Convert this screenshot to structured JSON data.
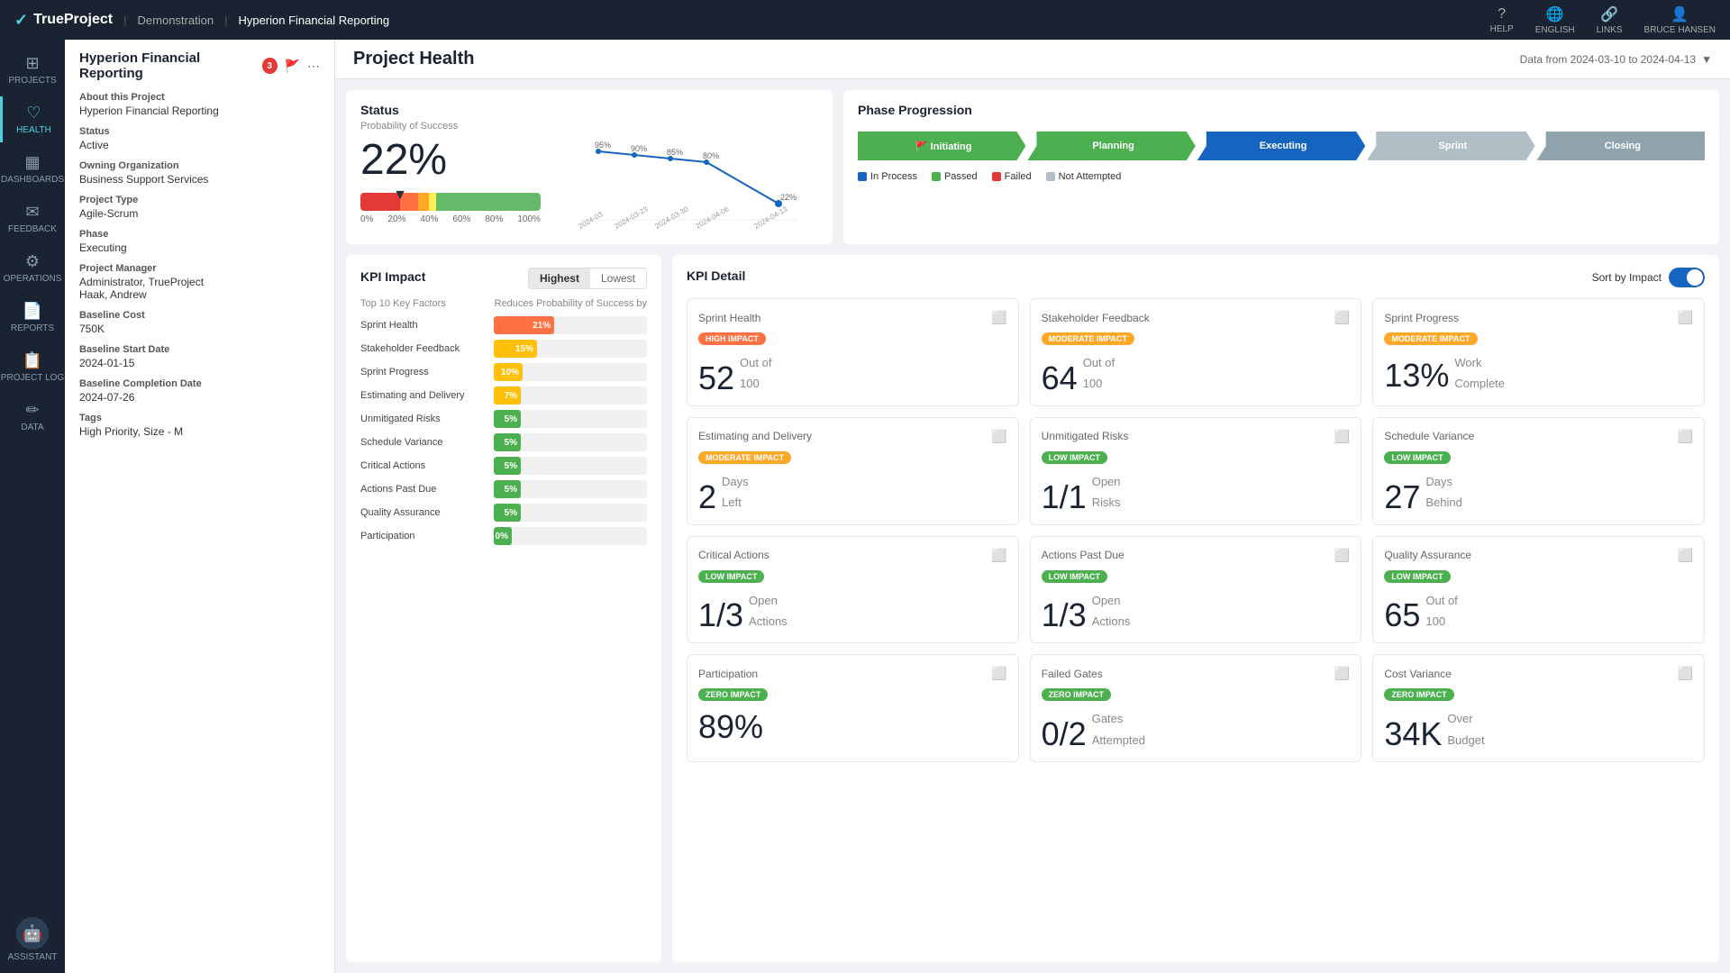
{
  "app": {
    "name": "TrueProject",
    "env": "Demonstration",
    "project": "Hyperion Financial Reporting"
  },
  "nav": {
    "help": "HELP",
    "language": "ENGLISH",
    "links": "LINKS",
    "user": "BRUCE HANSEN"
  },
  "sidebar": {
    "items": [
      {
        "id": "projects",
        "label": "PROJECTS",
        "icon": "⊞"
      },
      {
        "id": "health",
        "label": "HEALTH",
        "icon": "♡",
        "active": true
      },
      {
        "id": "dashboards",
        "label": "DASHBOARDS",
        "icon": "◫"
      },
      {
        "id": "feedback",
        "label": "FEEDBACK",
        "icon": "✉"
      },
      {
        "id": "operations",
        "label": "OPERATIONS",
        "icon": "⚙"
      },
      {
        "id": "reports",
        "label": "REPORTS",
        "icon": "📄"
      },
      {
        "id": "project_log",
        "label": "PROJECT LOG",
        "icon": "📋"
      },
      {
        "id": "data",
        "label": "DATA",
        "icon": "✏"
      }
    ],
    "assistant": "ASSISTANT"
  },
  "page": {
    "title": "Project Health",
    "date_range": "Data from 2024-03-10 to 2024-04-13"
  },
  "project_info": {
    "name": "Hyperion Financial Reporting",
    "badge": "3",
    "about_label": "About this Project",
    "about_value": "Hyperion Financial Reporting",
    "status_label": "Status",
    "status_value": "Active",
    "org_label": "Owning Organization",
    "org_value": "Business Support Services",
    "type_label": "Project Type",
    "type_value": "Agile-Scrum",
    "phase_label": "Phase",
    "phase_value": "Executing",
    "manager_label": "Project Manager",
    "manager_value": "Administrator, TrueProject\nHaak, Andrew",
    "cost_label": "Baseline Cost",
    "cost_value": "750K",
    "start_label": "Baseline Start Date",
    "start_value": "2024-01-15",
    "completion_label": "Baseline Completion Date",
    "completion_value": "2024-07-26",
    "tags_label": "Tags",
    "tags_value": "High Priority, Size - M"
  },
  "status": {
    "title": "Status",
    "subtitle": "Probability of Success",
    "percent": "22%",
    "chart_points": [
      {
        "label": "2024-03",
        "y": 95
      },
      {
        "label": "2024-03-23",
        "y": 90
      },
      {
        "label": "2024-03-30",
        "y": 85
      },
      {
        "label": "2024-04-06",
        "y": 80
      },
      {
        "label": "2024-04-13",
        "y": 22
      }
    ],
    "chart_labels": [
      "95%",
      "90%",
      "85%",
      "80%",
      "",
      "22%"
    ],
    "bar_labels": [
      "0%",
      "20%",
      "40%",
      "60%",
      "80%",
      "100%"
    ]
  },
  "phase_progression": {
    "title": "Phase Progression",
    "phases": [
      {
        "label": "Initiating",
        "status": "passed",
        "has_flag": true
      },
      {
        "label": "Planning",
        "status": "passed"
      },
      {
        "label": "Executing",
        "status": "in_process"
      },
      {
        "label": "Sprint",
        "status": "not_attempted"
      },
      {
        "label": "Closing",
        "status": "not_attempted"
      }
    ],
    "legend": [
      {
        "label": "In Process",
        "color": "#1565c0"
      },
      {
        "label": "Passed",
        "color": "#4caf50"
      },
      {
        "label": "Failed",
        "color": "#e53935"
      },
      {
        "label": "Not Attempted",
        "color": "#b0bec5"
      }
    ]
  },
  "kpi_impact": {
    "title": "KPI Impact",
    "toggle_highest": "Highest",
    "toggle_lowest": "Lowest",
    "col1": "Top 10 Key Factors",
    "col2": "Reduces Probability of Success by",
    "items": [
      {
        "label": "Sprint Health",
        "pct": 21,
        "color": "#ff7043",
        "pct_label": "21%"
      },
      {
        "label": "Stakeholder Feedback",
        "pct": 15,
        "color": "#ffc107",
        "pct_label": "15%"
      },
      {
        "label": "Sprint Progress",
        "pct": 10,
        "color": "#ffc107",
        "pct_label": "10%"
      },
      {
        "label": "Estimating and Delivery",
        "pct": 7,
        "color": "#ffc107",
        "pct_label": "7%"
      },
      {
        "label": "Unmitigated Risks",
        "pct": 5,
        "color": "#4caf50",
        "pct_label": "5%"
      },
      {
        "label": "Schedule Variance",
        "pct": 5,
        "color": "#4caf50",
        "pct_label": "5%"
      },
      {
        "label": "Critical Actions",
        "pct": 5,
        "color": "#4caf50",
        "pct_label": "5%"
      },
      {
        "label": "Actions Past Due",
        "pct": 5,
        "color": "#4caf50",
        "pct_label": "5%"
      },
      {
        "label": "Quality Assurance",
        "pct": 5,
        "color": "#4caf50",
        "pct_label": "5%"
      },
      {
        "label": "Participation",
        "pct": 0,
        "color": "#4caf50",
        "pct_label": "0%"
      }
    ]
  },
  "kpi_detail": {
    "title": "KPI Detail",
    "sort_label": "Sort by Impact",
    "cards": [
      {
        "title": "Sprint Health",
        "impact": "HIGH IMPACT",
        "impact_class": "high-impact",
        "value": "52",
        "suffix": "Out of",
        "suffix2": "100",
        "value_type": "number"
      },
      {
        "title": "Stakeholder Feedback",
        "impact": "MODERATE IMPACT",
        "impact_class": "moderate-impact",
        "value": "64",
        "suffix": "Out of",
        "suffix2": "100",
        "value_type": "number"
      },
      {
        "title": "Sprint Progress",
        "impact": "MODERATE IMPACT",
        "impact_class": "moderate-impact",
        "value": "13%",
        "suffix": "Work",
        "suffix2": "Complete",
        "value_type": "percent"
      },
      {
        "title": "Estimating and Delivery",
        "impact": "MODERATE IMPACT",
        "impact_class": "moderate-impact",
        "value": "2",
        "suffix": "Days",
        "suffix2": "Left",
        "value_type": "number"
      },
      {
        "title": "Unmitigated Risks",
        "impact": "LOW IMPACT",
        "impact_class": "low-impact",
        "value": "1/1",
        "suffix": "Open",
        "suffix2": "Risks",
        "value_type": "fraction"
      },
      {
        "title": "Schedule Variance",
        "impact": "LOW IMPACT",
        "impact_class": "low-impact",
        "value": "27",
        "suffix": "Days",
        "suffix2": "Behind",
        "value_type": "number"
      },
      {
        "title": "Critical Actions",
        "impact": "LOW IMPACT",
        "impact_class": "low-impact",
        "value": "1/3",
        "suffix": "Open",
        "suffix2": "Actions",
        "value_type": "fraction"
      },
      {
        "title": "Actions Past Due",
        "impact": "LOW IMPACT",
        "impact_class": "low-impact",
        "value": "1/3",
        "suffix": "Open",
        "suffix2": "Actions",
        "value_type": "fraction"
      },
      {
        "title": "Quality Assurance",
        "impact": "LOW IMPACT",
        "impact_class": "low-impact",
        "value": "65",
        "suffix": "Out of",
        "suffix2": "100",
        "value_type": "number"
      },
      {
        "title": "Participation",
        "impact": "ZERO IMPACT",
        "impact_class": "zero-impact",
        "value": "89%",
        "suffix": "",
        "suffix2": "",
        "value_type": "percent"
      },
      {
        "title": "Failed Gates",
        "impact": "ZERO IMPACT",
        "impact_class": "zero-impact",
        "value": "0/2",
        "suffix": "Gates",
        "suffix2": "Attempted",
        "value_type": "fraction"
      },
      {
        "title": "Cost Variance",
        "impact": "ZERO IMPACT",
        "impact_class": "zero-impact",
        "value": "34K",
        "suffix": "Over",
        "suffix2": "Budget",
        "value_type": "number"
      }
    ]
  }
}
